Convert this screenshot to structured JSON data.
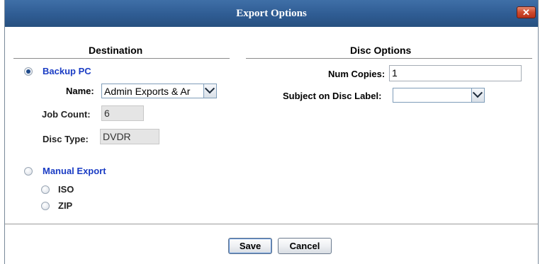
{
  "dialog": {
    "title": "Export Options",
    "close_label": "✕"
  },
  "destination": {
    "header": "Destination",
    "backup_pc_label": "Backup PC",
    "name_label": "Name:",
    "name_value": "Admin Exports & Ar",
    "job_count_label": "Job Count:",
    "job_count_value": "6",
    "disc_type_label": "Disc Type:",
    "disc_type_value": "DVDR",
    "manual_export_label": "Manual Export",
    "iso_label": "ISO",
    "zip_label": "ZIP",
    "selected": "Backup PC"
  },
  "disc_options": {
    "header": "Disc Options",
    "num_copies_label": "Num Copies:",
    "num_copies_value": "1",
    "subject_label": "Subject on Disc Label:",
    "subject_value": ""
  },
  "footer": {
    "save_label": "Save",
    "cancel_label": "Cancel"
  },
  "colors": {
    "title_bar": "#2f5c93",
    "link_blue": "#1a3cc4",
    "close_red": "#cf4a2c"
  }
}
